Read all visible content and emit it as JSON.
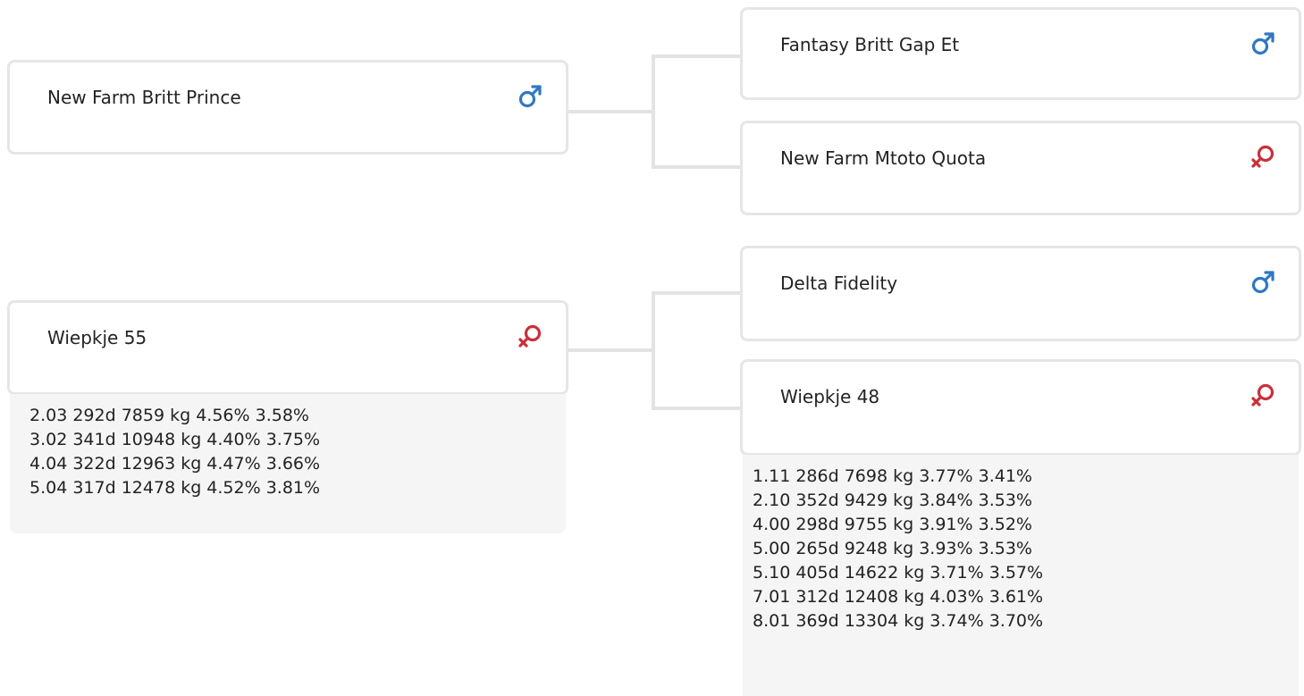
{
  "pedigree": {
    "subjects": [
      {
        "name": "New Farm Britt Prince",
        "sex": "male",
        "icon": "male-icon",
        "color": "#2f78c4",
        "records": []
      },
      {
        "name": "Wiepkje 55",
        "sex": "female",
        "icon": "female-icon",
        "color": "#c9303a",
        "records": [
          "2.03 292d 7859 kg 4.56% 3.58%",
          "3.02 341d 10948 kg 4.40% 3.75%",
          "4.04 322d 12963 kg 4.47% 3.66%",
          "5.04 317d 12478 kg 4.52% 3.81%"
        ]
      }
    ],
    "ancestors": [
      {
        "name": "Fantasy Britt Gap Et",
        "sex": "male",
        "icon": "male-icon",
        "color": "#2f78c4",
        "records": []
      },
      {
        "name": "New Farm Mtoto Quota",
        "sex": "female",
        "icon": "female-icon",
        "color": "#c9303a",
        "records": []
      },
      {
        "name": "Delta Fidelity",
        "sex": "male",
        "icon": "male-icon",
        "color": "#2f78c4",
        "records": []
      },
      {
        "name": "Wiepkje 48",
        "sex": "female",
        "icon": "female-icon",
        "color": "#c9303a",
        "records": [
          "1.11 286d 7698 kg 3.77% 3.41%",
          "2.10 352d 9429 kg 3.84% 3.53%",
          "4.00 298d 9755 kg 3.91% 3.52%",
          "5.00 265d 9248 kg 3.93% 3.53%",
          "5.10 405d 14622 kg 3.71% 3.57%",
          "7.01 312d 12408 kg 4.03% 3.61%",
          "8.01 369d 13304 kg 3.74% 3.70%"
        ]
      }
    ]
  }
}
